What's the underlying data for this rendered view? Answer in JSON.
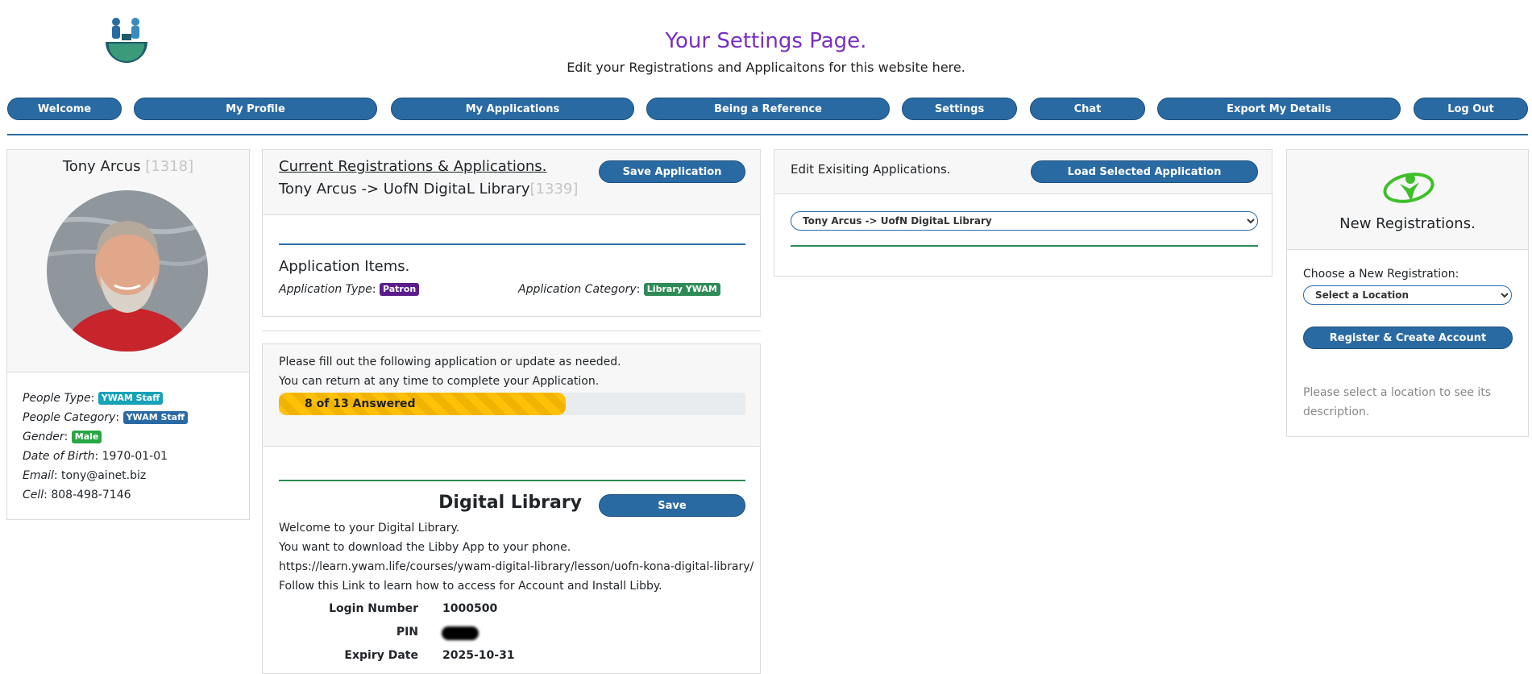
{
  "header": {
    "title": "Your Settings Page.",
    "subtitle": "Edit your Registrations and Applicaitons for this website here."
  },
  "nav": [
    {
      "label": "Welcome"
    },
    {
      "label": "My Profile"
    },
    {
      "label": "My Applications"
    },
    {
      "label": "Being a Reference"
    },
    {
      "label": "Settings"
    },
    {
      "label": "Chat"
    },
    {
      "label": "Export My Details"
    },
    {
      "label": "Log Out"
    }
  ],
  "profile": {
    "name": "Tony Arcus",
    "id": "[1318]",
    "people_type_label": "People Type",
    "people_type": "YWAM Staff",
    "people_category_label": "People Category",
    "people_category": "YWAM Staff",
    "gender_label": "Gender",
    "gender": "Male",
    "dob_label": "Date of Birth",
    "dob": "1970-01-01",
    "email_label": "Email",
    "email": "tony@ainet.biz",
    "cell_label": "Cell",
    "cell": "808-498-7146"
  },
  "current": {
    "heading": "Current Registrations & Applications.",
    "app_name": "Tony Arcus -> UofN DigitaL Library",
    "app_id": "[1339]",
    "save_label": "Save Application",
    "items_heading": "Application Items.",
    "type_label": "Application Type",
    "type_value": "Patron",
    "category_label": "Application Category",
    "category_value": "Library YWAM",
    "fill_line1": "Please fill out the following application or update as needed.",
    "fill_line2": "You can return at any time to complete your Application.",
    "progress_text": "8 of 13 Answered",
    "progress_fraction": 0.615
  },
  "library": {
    "title": "Digital Library",
    "save_label": "Save",
    "line1": "Welcome to your Digital Library.",
    "line2": "You want to download the Libby App to your phone.",
    "line3": "https://learn.ywam.life/courses/ywam-digital-library/lesson/uofn-kona-digital-library/",
    "line4": "Follow this Link to learn how to access for Account and Install Libby.",
    "login_label": "Login Number",
    "login_value": "1000500",
    "pin_label": "PIN",
    "expiry_label": "Expiry Date",
    "expiry_value": "2025-10-31"
  },
  "edit": {
    "heading": "Edit Exisiting Applications.",
    "load_label": "Load Selected Application",
    "selected": "Tony Arcus -> UofN DigitaL Library"
  },
  "newreg": {
    "heading": "New Registrations.",
    "choose_label": "Choose a New Registration:",
    "location_selected": "Select a Location",
    "register_label": "Register & Create Account",
    "hint": "Please select a location to see its description."
  },
  "colors": {
    "primary": "#2a6aa3",
    "title": "#7a2ec0",
    "badge_staff": "#17a2b8",
    "badge_male": "#28a745",
    "badge_patron": "#5b1d8c",
    "badge_library": "#2e8b57",
    "progress": "#ffc107"
  }
}
